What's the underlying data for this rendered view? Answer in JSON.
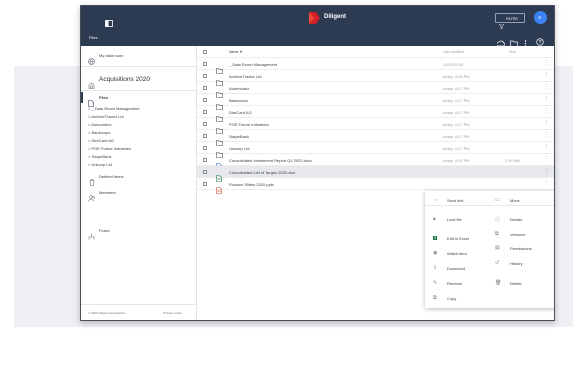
{
  "app": {
    "brand": "Diligent",
    "filter_label": "FILTER",
    "avatar_initial": "K",
    "breadcrumb": "Files"
  },
  "sidebar": {
    "my_data_room": "My data room",
    "room_title": "Acquisitions 2020",
    "files_label": "Files",
    "tree": [
      "> _ Data Room Management",
      "> ArchiveTractor Ltd",
      "> Automobex",
      "> Bankcorps",
      "> DireCard AG",
      "> POE Future Industries",
      "> SwipeBank",
      "> Unicorp Ltd"
    ],
    "deleted_items": "Deleted items",
    "members": "Members",
    "flows": "Flows",
    "footer_copyright": "© 2020 Diligent Corporation",
    "footer_privacy": "Privacy notice"
  },
  "table": {
    "col_name": "Name ▼",
    "col_modified": "Last modified",
    "col_size": "Size",
    "rows": [
      {
        "name": "_ Data Room Management",
        "modified": "10/02/2020",
        "size": "",
        "kind": "folder"
      },
      {
        "name": "ArchiveTractor Ltd",
        "modified": "today, 4:26 PM",
        "size": "",
        "kind": "folder"
      },
      {
        "name": "Automobex",
        "modified": "today, 4:27 PM",
        "size": "",
        "kind": "folder"
      },
      {
        "name": "Bankcorps",
        "modified": "today, 4:27 PM",
        "size": "",
        "kind": "folder"
      },
      {
        "name": "DireCard AG",
        "modified": "today, 4:27 PM",
        "size": "",
        "kind": "folder"
      },
      {
        "name": "POE Future Industries",
        "modified": "today, 4:27 PM",
        "size": "",
        "kind": "folder"
      },
      {
        "name": "SwipeBank",
        "modified": "today, 4:27 PM",
        "size": "",
        "kind": "folder"
      },
      {
        "name": "Unicorp Ltd",
        "modified": "today, 4:27 PM",
        "size": "",
        "kind": "folder"
      },
      {
        "name": "Consolidated Investment Report Q1 2020.docx",
        "modified": "today, 4:31 PM",
        "size": "2.99 MB",
        "kind": "docx"
      },
      {
        "name": "Consolidated List of Targes 2020.xlsx",
        "modified": "",
        "size": "",
        "kind": "xlsx"
      },
      {
        "name": "Finance Slides 2020.pptx",
        "modified": "",
        "size": "",
        "kind": "pptx"
      }
    ]
  },
  "context_menu": {
    "left": [
      "Send link",
      "Lock file",
      "Edit in Excel",
      "Watch item",
      "Download",
      "Rename",
      "Copy"
    ],
    "right": [
      "Move",
      "Details",
      "Versions",
      "Permissions",
      "History",
      "Delete"
    ]
  },
  "colors": {
    "navy": "#2c3a52",
    "brand_red": "#d0202a",
    "avatar_blue": "#3b82f6",
    "excel_green": "#1e7a45"
  }
}
